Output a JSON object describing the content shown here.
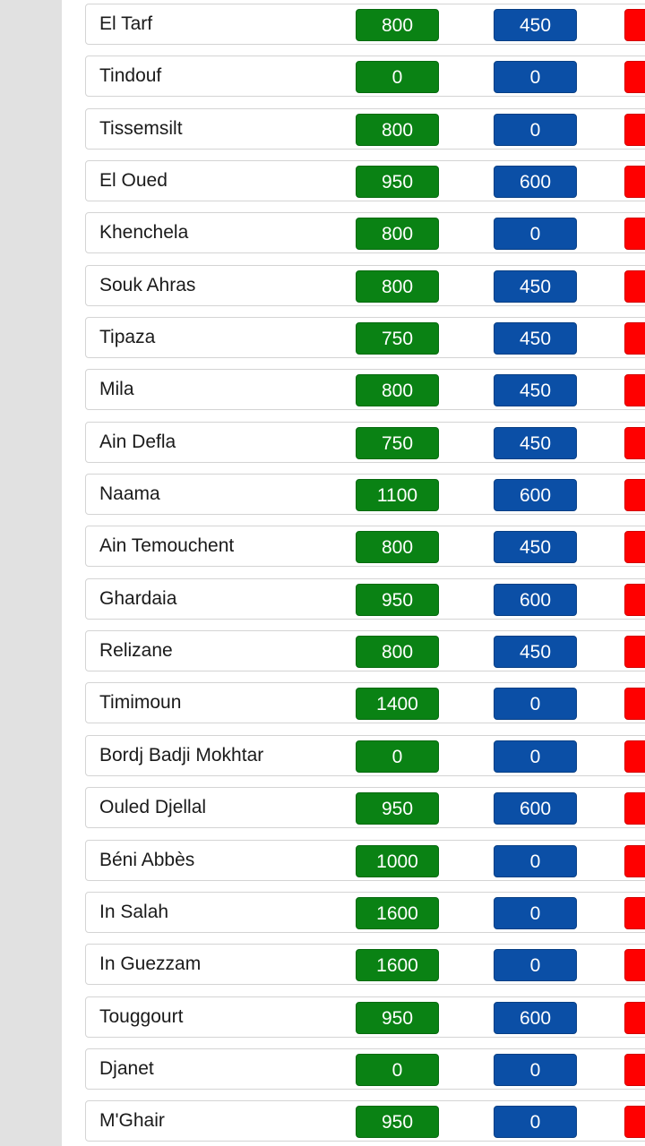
{
  "colors": {
    "home_badge": "#0a8214",
    "desk_badge": "#0b4fa6",
    "extra_badge": "#ff0000",
    "gutter": "#e1e1e1"
  },
  "rows": [
    {
      "name": "El Tarf",
      "home": "800",
      "desk": "450"
    },
    {
      "name": "Tindouf",
      "home": "0",
      "desk": "0"
    },
    {
      "name": "Tissemsilt",
      "home": "800",
      "desk": "0"
    },
    {
      "name": "El Oued",
      "home": "950",
      "desk": "600"
    },
    {
      "name": "Khenchela",
      "home": "800",
      "desk": "0"
    },
    {
      "name": "Souk Ahras",
      "home": "800",
      "desk": "450"
    },
    {
      "name": "Tipaza",
      "home": "750",
      "desk": "450"
    },
    {
      "name": "Mila",
      "home": "800",
      "desk": "450"
    },
    {
      "name": "Ain Defla",
      "home": "750",
      "desk": "450"
    },
    {
      "name": "Naama",
      "home": "1100",
      "desk": "600"
    },
    {
      "name": "Ain Temouchent",
      "home": "800",
      "desk": "450"
    },
    {
      "name": "Ghardaia",
      "home": "950",
      "desk": "600"
    },
    {
      "name": "Relizane",
      "home": "800",
      "desk": "450"
    },
    {
      "name": "Timimoun",
      "home": "1400",
      "desk": "0"
    },
    {
      "name": "Bordj Badji Mokhtar",
      "home": "0",
      "desk": "0"
    },
    {
      "name": "Ouled Djellal",
      "home": "950",
      "desk": "600"
    },
    {
      "name": "Béni Abbès",
      "home": "1000",
      "desk": "0"
    },
    {
      "name": "In Salah",
      "home": "1600",
      "desk": "0"
    },
    {
      "name": "In Guezzam",
      "home": "1600",
      "desk": "0"
    },
    {
      "name": "Touggourt",
      "home": "950",
      "desk": "600"
    },
    {
      "name": "Djanet",
      "home": "0",
      "desk": "0"
    },
    {
      "name": "M'Ghair",
      "home": "950",
      "desk": "0"
    }
  ]
}
